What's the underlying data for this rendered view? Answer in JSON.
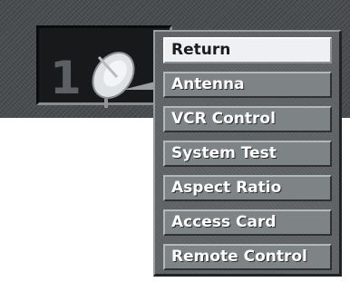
{
  "channel": {
    "number": "1",
    "icon": "satellite-dish-icon"
  },
  "menu": {
    "selected_index": 0,
    "items": [
      {
        "label": "Return"
      },
      {
        "label": "Antenna"
      },
      {
        "label": "VCR Control"
      },
      {
        "label": "System Test"
      },
      {
        "label": "Aspect Ratio"
      },
      {
        "label": "Access Card"
      },
      {
        "label": "Remote Control"
      }
    ]
  },
  "colors": {
    "banner": "#4a4d50",
    "menu_item": "#7e8386",
    "menu_item_selected": "#eef0f1"
  }
}
